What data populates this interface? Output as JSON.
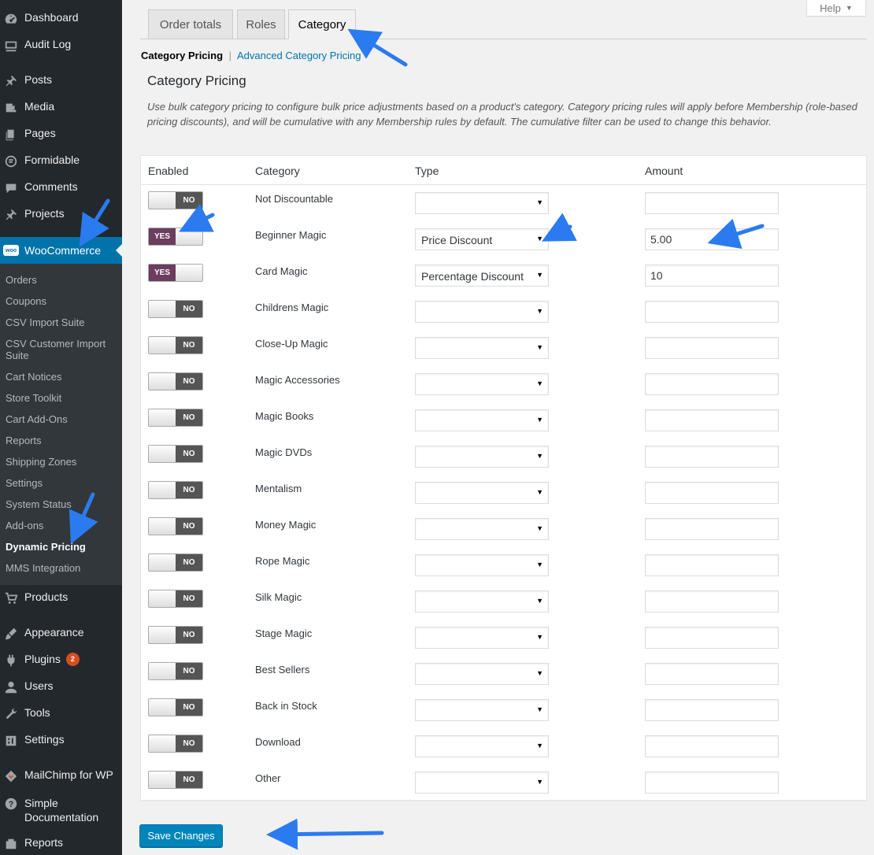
{
  "sidebar": {
    "top_items": [
      {
        "label": "Dashboard",
        "icon": "dashboard-icon"
      },
      {
        "label": "Audit Log",
        "icon": "audit-log-icon"
      },
      {
        "label": "Posts",
        "icon": "pin-icon"
      },
      {
        "label": "Media",
        "icon": "media-icon"
      },
      {
        "label": "Pages",
        "icon": "pages-icon"
      },
      {
        "label": "Formidable",
        "icon": "formidable-icon"
      },
      {
        "label": "Comments",
        "icon": "comments-icon"
      },
      {
        "label": "Projects",
        "icon": "pin-icon"
      }
    ],
    "woocommerce": {
      "label": "WooCommerce",
      "logo_text": "woo"
    },
    "submenu": [
      "Orders",
      "Coupons",
      "CSV Import Suite",
      "CSV Customer Import Suite",
      "Cart Notices",
      "Store Toolkit",
      "Cart Add-Ons",
      "Reports",
      "Shipping Zones",
      "Settings",
      "System Status",
      "Add-ons",
      "Dynamic Pricing",
      "MMS Integration"
    ],
    "current_submenu": "Dynamic Pricing",
    "bottom_items": [
      {
        "label": "Products",
        "icon": "cart-icon"
      },
      {
        "label": "Appearance",
        "icon": "brush-icon"
      },
      {
        "label": "Plugins",
        "icon": "plugin-icon",
        "badge": "2"
      },
      {
        "label": "Users",
        "icon": "users-icon"
      },
      {
        "label": "Tools",
        "icon": "wrench-icon"
      },
      {
        "label": "Settings",
        "icon": "settings-icon"
      },
      {
        "label": "MailChimp for WP",
        "icon": "mailchimp-icon"
      },
      {
        "label": "Simple Documentation",
        "icon": "help-icon"
      },
      {
        "label": "Reports",
        "icon": "reports-icon"
      }
    ]
  },
  "help_tab": {
    "label": "Help",
    "caret": "▼"
  },
  "tabs": [
    {
      "label": "Order totals",
      "active": false
    },
    {
      "label": "Roles",
      "active": false
    },
    {
      "label": "Category",
      "active": true
    }
  ],
  "subnav": {
    "current": "Category Pricing",
    "separator": "|",
    "link": "Advanced Category Pricing"
  },
  "section": {
    "title": "Category Pricing",
    "description": "Use bulk category pricing to configure bulk price adjustments based on a product's category. Category pricing rules will apply before Membership (role-based pricing discounts), and will be cumulative with any Membership rules by default. The cumulative filter can be used to change this behavior."
  },
  "table": {
    "headers": {
      "enabled": "Enabled",
      "category": "Category",
      "type": "Type",
      "amount": "Amount"
    },
    "on_label": "YES",
    "off_label": "NO",
    "rows": [
      {
        "category": "Not Discountable",
        "enabled": false,
        "type": "",
        "amount": ""
      },
      {
        "category": "Beginner Magic",
        "enabled": true,
        "type": "Price Discount",
        "amount": "5.00"
      },
      {
        "category": "Card Magic",
        "enabled": true,
        "type": "Percentage Discount",
        "amount": "10"
      },
      {
        "category": "Childrens Magic",
        "enabled": false,
        "type": "",
        "amount": ""
      },
      {
        "category": "Close-Up Magic",
        "enabled": false,
        "type": "",
        "amount": ""
      },
      {
        "category": "Magic Accessories",
        "enabled": false,
        "type": "",
        "amount": ""
      },
      {
        "category": "Magic Books",
        "enabled": false,
        "type": "",
        "amount": ""
      },
      {
        "category": "Magic DVDs",
        "enabled": false,
        "type": "",
        "amount": ""
      },
      {
        "category": "Mentalism",
        "enabled": false,
        "type": "",
        "amount": ""
      },
      {
        "category": "Money Magic",
        "enabled": false,
        "type": "",
        "amount": ""
      },
      {
        "category": "Rope Magic",
        "enabled": false,
        "type": "",
        "amount": ""
      },
      {
        "category": "Silk Magic",
        "enabled": false,
        "type": "",
        "amount": ""
      },
      {
        "category": "Stage Magic",
        "enabled": false,
        "type": "",
        "amount": ""
      },
      {
        "category": "Best Sellers",
        "enabled": false,
        "type": "",
        "amount": ""
      },
      {
        "category": "Back in Stock",
        "enabled": false,
        "type": "",
        "amount": ""
      },
      {
        "category": "Download",
        "enabled": false,
        "type": "",
        "amount": ""
      },
      {
        "category": "Other",
        "enabled": false,
        "type": "",
        "amount": ""
      }
    ]
  },
  "save_button": {
    "label": "Save Changes"
  },
  "colors": {
    "sidebar_bg": "#23282d",
    "submenu_bg": "#32373c",
    "accent": "#0073aa",
    "toggle_on": "#6b3d5e",
    "toggle_off": "#555555",
    "annotation_arrow": "#2b7bf0"
  }
}
